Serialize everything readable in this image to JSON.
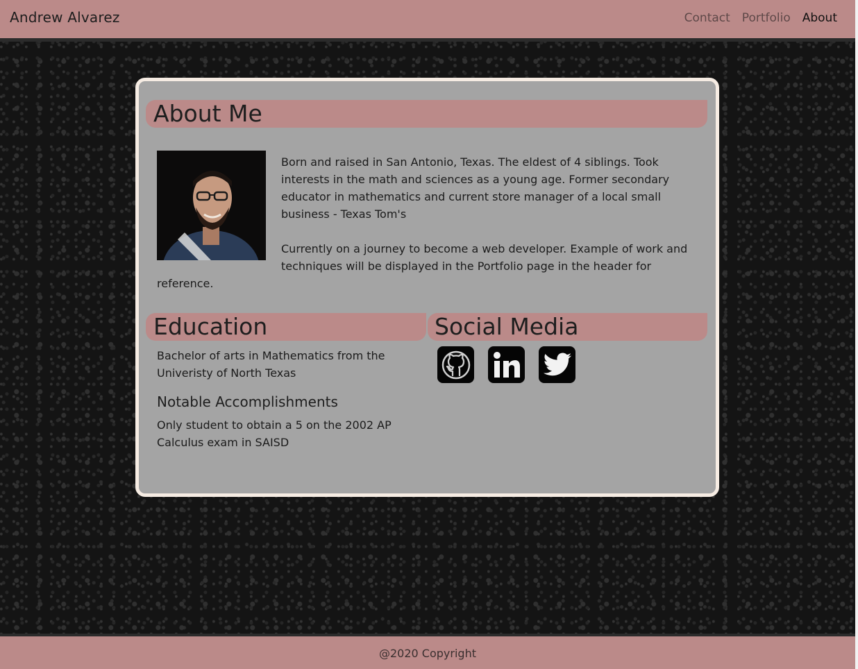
{
  "header": {
    "brand": "Andrew Alvarez",
    "nav": [
      {
        "label": "Contact",
        "active": false
      },
      {
        "label": "Portfolio",
        "active": false
      },
      {
        "label": "About",
        "active": true
      }
    ]
  },
  "about": {
    "heading": "About Me",
    "photo_alt": "Portrait of Andrew Alvarez",
    "paragraph_1": "Born and raised in San Antonio, Texas. The eldest of 4 siblings. Took interests in the math and sciences as a young age. Former secondary educator in mathematics and current store manager of a local small business - Texas Tom's",
    "paragraph_2": "Currently on a journey to become a web developer. Example of work and techniques will be displayed in the Portfolio page in the header for reference."
  },
  "education": {
    "heading": "Education",
    "degree": "Bachelor of arts in Mathematics from the Univeristy of North Texas",
    "accomplishments_heading": "Notable Accomplishments",
    "accomplishment": "Only student to obtain a 5 on the 2002 AP Calculus exam in SAISD"
  },
  "social": {
    "heading": "Social Media",
    "icons": [
      "github-icon",
      "linkedin-icon",
      "twitter-icon"
    ]
  },
  "footer": {
    "copyright": "@2020 Copyright"
  },
  "colors": {
    "accent": "#bb8a89",
    "card_bg": "#a4a4a4",
    "card_border": "#f6ece3"
  }
}
